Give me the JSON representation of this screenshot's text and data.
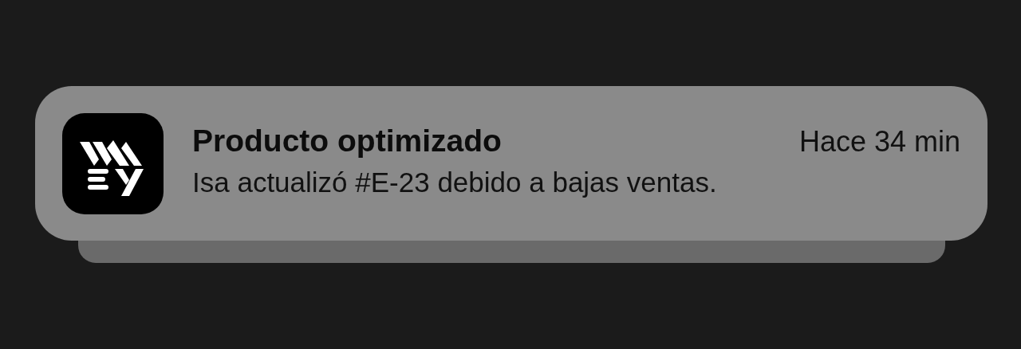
{
  "notification": {
    "title": "Producto optimizado",
    "time": "Hace 34 min",
    "body": "Isa actualizó #E-23 debido a bajas ventas.",
    "stacked": true
  }
}
